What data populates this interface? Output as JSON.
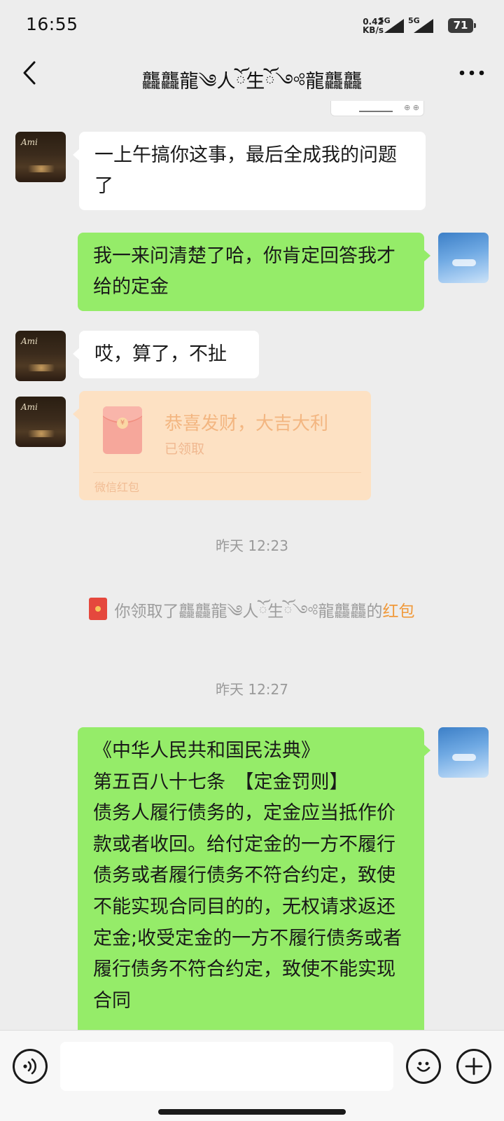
{
  "status_bar": {
    "time": "16:55",
    "net_speed": "0.42",
    "net_unit": "KB/s",
    "sim1": "5G",
    "sim2": "5G",
    "battery": "71"
  },
  "header": {
    "title": "龘龘龍༄人ོ生ོ༺龍龘龘"
  },
  "messages": {
    "m1": "一上午搞你这事，最后全成我的问题了",
    "m2": "我一来问清楚了哈，你肯定回答我才给的定金",
    "m3": "哎，算了，不扯"
  },
  "red_packet": {
    "title": "恭喜发财，大吉大利",
    "status": "已领取",
    "footer": "微信红包",
    "coin": "¥"
  },
  "timestamps": {
    "t1": "昨天 12:23",
    "t2": "昨天 12:27"
  },
  "system_message": {
    "text": "你领取了龘龘龍༄人ོ生ོ༺龍龘龘的",
    "link": "红包"
  },
  "law_message": {
    "line1": "《中华人民共和国民法典》",
    "line2": "第五百八十七条　【定金罚则】",
    "body": "债务人履行债务的，定金应当抵作价款或者收回。给付定金的一方不履行债务或者履行债务不符合约定，致使不能实现合同目的的，无权请求返还定金;收受定金的一方不履行债务或者履行债务不符合约定，致使不能实现合同"
  },
  "input": {
    "value": ""
  }
}
